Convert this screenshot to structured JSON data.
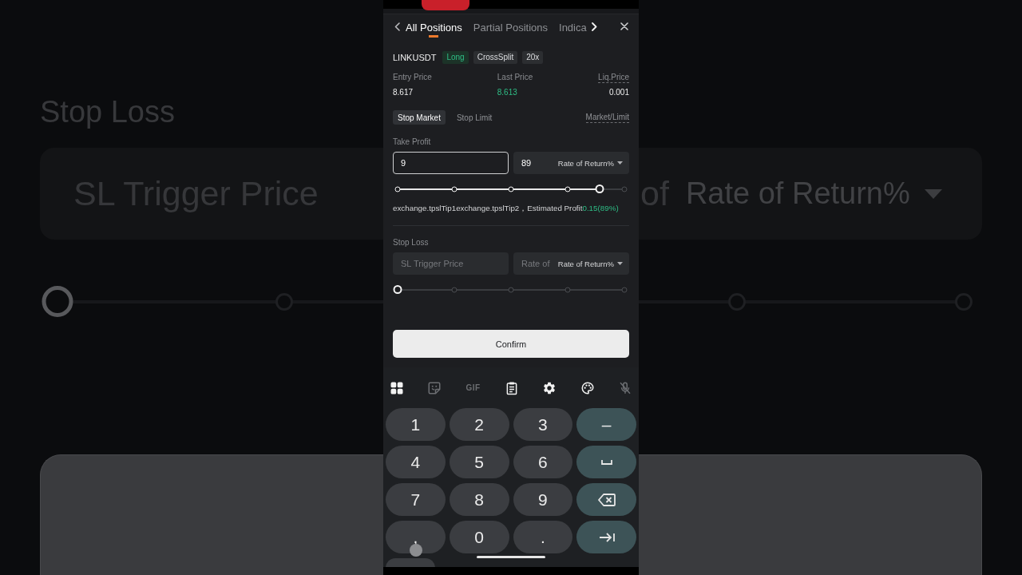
{
  "background_blur": {
    "label": "Stop Loss",
    "placeholder": "SL Trigger Price",
    "unit_prefix": "of",
    "unit": "Rate of Return%",
    "slider": {
      "level": 0
    }
  },
  "tabs": [
    {
      "label": "All Positions",
      "selected": true
    },
    {
      "label": "Partial Positions",
      "selected": false
    },
    {
      "label": "Indica",
      "selected": false
    }
  ],
  "position": {
    "symbol": "LINKUSDT",
    "tags": [
      {
        "label": "Long",
        "kind": "side"
      },
      {
        "label": "CrossSplit",
        "kind": "mode"
      },
      {
        "label": "20x",
        "kind": "mode"
      }
    ],
    "stats": [
      {
        "label": "Entry Price",
        "value": "8.617",
        "kind": "plain"
      },
      {
        "label": "Last Price",
        "value": "8.613",
        "kind": "rise"
      },
      {
        "label": "Liq.Price",
        "value": "0.001",
        "kind": "hint"
      }
    ]
  },
  "order_types": [
    {
      "label": "Stop Market",
      "selected": true
    },
    {
      "label": "Stop Limit",
      "selected": false
    }
  ],
  "price_mode": "Market/Limit",
  "take_profit": {
    "label": "Take Profit",
    "price": {
      "value": "9",
      "focused": true
    },
    "rate": {
      "value": "89",
      "unit": "Rate of Return%"
    },
    "slider": {
      "level": 0.89
    },
    "tip": "exchange.tpslTip1exchange.tpslTip2，Estimated Profit",
    "profit": "0.15(89%)"
  },
  "stop_loss": {
    "label": "Stop Loss",
    "price": {
      "placeholder": "SL Trigger Price",
      "focused": false
    },
    "rate": {
      "placeholder": "Rate of",
      "unit": "Rate of Return%"
    },
    "slider": {
      "level": 0
    }
  },
  "confirm": "Confirm",
  "keyboard": {
    "toolbar": [
      {
        "kind": "apps",
        "disabled": false
      },
      {
        "kind": "sticker",
        "disabled": true
      },
      {
        "kind": "gif",
        "label": "GIF",
        "disabled": true
      },
      {
        "kind": "clipboard",
        "disabled": false
      },
      {
        "kind": "settings",
        "disabled": false
      },
      {
        "kind": "palette",
        "disabled": false
      },
      {
        "kind": "mic",
        "disabled": true
      }
    ],
    "keys": [
      {
        "kind": "char",
        "label": "1"
      },
      {
        "kind": "char",
        "label": "2"
      },
      {
        "kind": "char",
        "label": "3"
      },
      {
        "kind": "func",
        "label": "–"
      },
      {
        "kind": "char",
        "label": "4"
      },
      {
        "kind": "char",
        "label": "5"
      },
      {
        "kind": "char",
        "label": "6"
      },
      {
        "kind": "space"
      },
      {
        "kind": "char",
        "label": "7"
      },
      {
        "kind": "char",
        "label": "8"
      },
      {
        "kind": "char",
        "label": "9"
      },
      {
        "kind": "backspace"
      },
      {
        "kind": "char",
        "label": ","
      },
      {
        "kind": "char",
        "label": "0"
      },
      {
        "kind": "char",
        "label": "."
      },
      {
        "kind": "next"
      }
    ]
  }
}
